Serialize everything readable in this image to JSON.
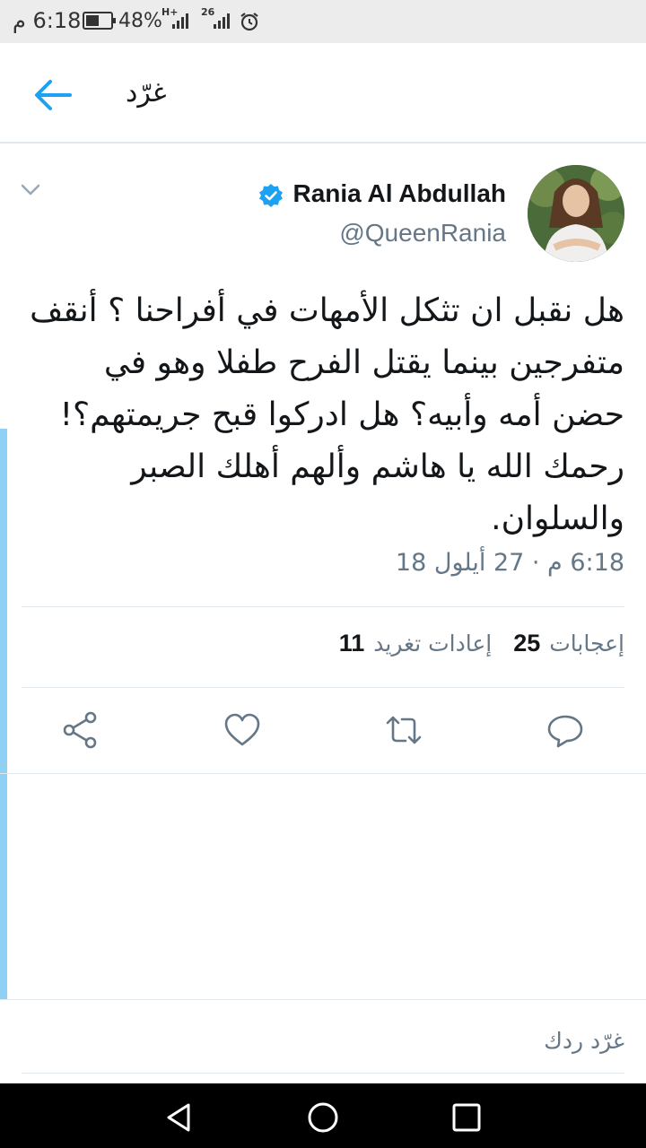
{
  "status_bar": {
    "time": "6:18 م",
    "battery_percent": "48%",
    "network_1": "H+",
    "network_2": "26",
    "icons": [
      "battery-icon",
      "signal-icon",
      "alarm-icon"
    ]
  },
  "header": {
    "title": "غرّد",
    "back_icon": "arrow-left-icon"
  },
  "tweet": {
    "display_name": "Rania Al Abdullah",
    "handle": "@QueenRania",
    "verified": true,
    "text": "هل نقبل ان تثكل الأمهات في أفراحنا ؟ أنقف متفرجين بينما يقتل الفرح طفلا وهو في حضن أمه وأبيه؟ هل ادركوا قبح جريمتهم؟! رحمك الله يا هاشم وألهم أهلك الصبر والسلوان.",
    "timestamp": "6:18 م · 27 أيلول 18"
  },
  "stats": {
    "retweets_count": "11",
    "retweets_label": "إعادات تغريد",
    "likes_count": "25",
    "likes_label": "إعجابات"
  },
  "actions": [
    "reply-icon",
    "retweet-icon",
    "like-icon",
    "share-icon"
  ],
  "reply_box": {
    "placeholder": "غرّد ردك"
  },
  "colors": {
    "accent": "#1da1f2",
    "secondary_text": "#657786",
    "divider": "#e1e8ed",
    "left_accent": "#8fd0f5"
  }
}
